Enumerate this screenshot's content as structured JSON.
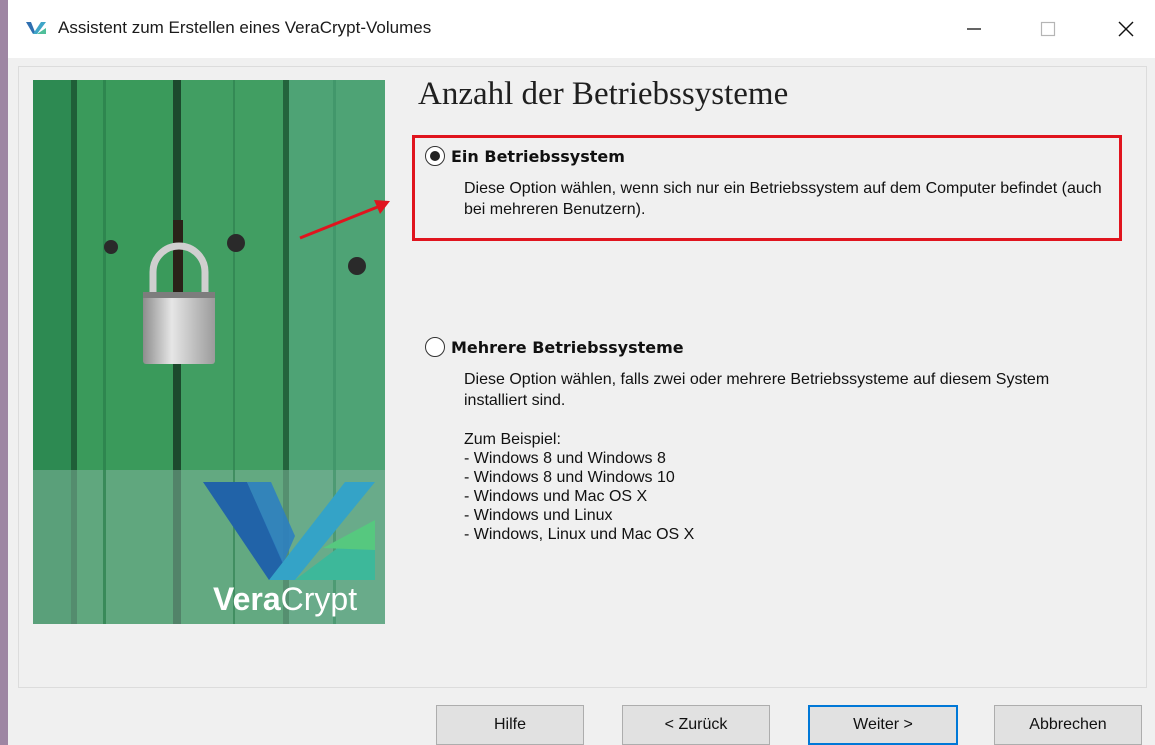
{
  "window": {
    "title": "Assistent zum Erstellen eines VeraCrypt-Volumes"
  },
  "page": {
    "heading": "Anzahl der Betriebssysteme"
  },
  "options": [
    {
      "label": "Ein Betriebssystem",
      "selected": true,
      "description": "Diese Option wählen, wenn sich nur ein Betriebssystem auf dem Computer befindet (auch bei mehreren Benutzern)."
    },
    {
      "label": "Mehrere Betriebssysteme",
      "selected": false,
      "description": "Diese Option wählen, falls zwei oder mehrere Betriebssysteme auf diesem System installiert sind.",
      "example_title": "Zum Beispiel:",
      "examples": [
        "- Windows 8 und Windows 8",
        "- Windows 8 und Windows 10",
        "- Windows und Mac OS X",
        "- Windows und Linux",
        "- Windows, Linux und Mac OS X"
      ]
    }
  ],
  "logo": {
    "text_bold": "Vera",
    "text_light": "Crypt"
  },
  "buttons": {
    "help": "Hilfe",
    "back": "< Zurück",
    "next": "Weiter >",
    "cancel": "Abbrechen"
  },
  "colors": {
    "highlight": "#e0141e",
    "default_button_border": "#0078d7",
    "door_green": "#3e9b5c"
  },
  "icons": [
    "veracrypt-app-icon",
    "minimize-icon",
    "maximize-icon",
    "close-icon",
    "padlock-icon",
    "veracrypt-logo",
    "arrow-annotation"
  ]
}
